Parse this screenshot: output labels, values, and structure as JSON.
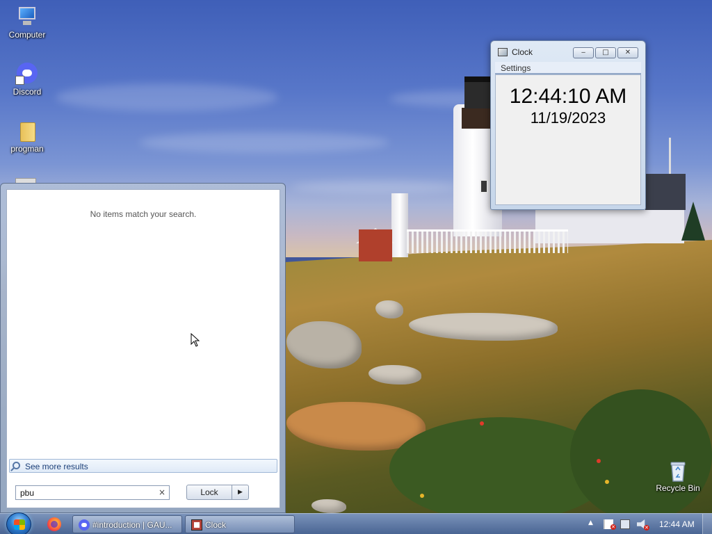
{
  "desktop": {
    "icons": [
      {
        "label": "Computer",
        "icon": "computer-icon"
      },
      {
        "label": "Discord",
        "icon": "discord-icon"
      },
      {
        "label": "progman",
        "icon": "folder-icon"
      },
      {
        "label": "Recycle Bin",
        "icon": "recycle-bin-icon"
      }
    ]
  },
  "clock_window": {
    "title": "Clock",
    "menu": [
      "Settings"
    ],
    "time": "12:44:10 AM",
    "date": "11/19/2023",
    "buttons": {
      "minimize": "‒",
      "maximize": "□",
      "close": "✕"
    }
  },
  "start_menu": {
    "no_results_text": "No items match your search.",
    "see_more_label": "See more results",
    "search_value": "pbu",
    "clear_glyph": "×",
    "lock_label": "Lock",
    "lock_arrow": "▶"
  },
  "taskbar": {
    "tasks": [
      {
        "label": "#introduction | GAU...",
        "icon": "discord-icon"
      },
      {
        "label": "Clock",
        "icon": "clock-app-icon"
      }
    ],
    "tray_arrow": "▲",
    "clock": "12:44 AM"
  }
}
